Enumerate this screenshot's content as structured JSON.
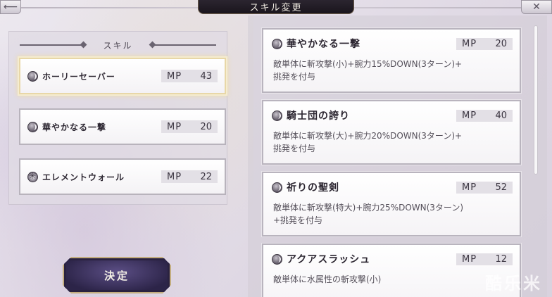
{
  "header": {
    "title": "スキル変更",
    "back_icon": "back-arrow-icon",
    "close_icon": "close-icon"
  },
  "equipped_panel": {
    "label": "スキル",
    "skills": [
      {
        "name": "ホーリーセーバー",
        "mp_label": "MP",
        "mp": "43",
        "icon": "slash-icon",
        "selected": true
      },
      {
        "name": "華やかなる一撃",
        "mp_label": "MP",
        "mp": "20",
        "icon": "slash-icon",
        "selected": false
      },
      {
        "name": "エレメントウォール",
        "mp_label": "MP",
        "mp": "22",
        "icon": "element-icon",
        "selected": false
      }
    ]
  },
  "decide_button": {
    "label": "決定"
  },
  "skill_list": [
    {
      "name": "華やかなる一撃",
      "mp_label": "MP",
      "mp": "20",
      "desc_line1": "敵単体に斬攻撃(小)+腕力15%DOWN(3ターン)+",
      "desc_line2": "挑発を付与"
    },
    {
      "name": "騎士団の誇り",
      "mp_label": "MP",
      "mp": "40",
      "desc_line1": "敵単体に斬攻撃(大)+腕力20%DOWN(3ターン)+",
      "desc_line2": "挑発を付与"
    },
    {
      "name": "祈りの聖剣",
      "mp_label": "MP",
      "mp": "52",
      "desc_line1": "敵単体に斬攻撃(特大)+腕力25%DOWN(3ターン)",
      "desc_line2": "+挑発を付与"
    },
    {
      "name": "アクアスラッシュ",
      "mp_label": "MP",
      "mp": "12",
      "desc_line1": "敵単体に水属性の斬攻撃(小)",
      "desc_line2": ""
    }
  ],
  "watermark": "酷乐米",
  "colors": {
    "selected_glow": "#f0dca0",
    "decide_bg": "#3b3160",
    "gold_border": "#c3ad7e"
  }
}
